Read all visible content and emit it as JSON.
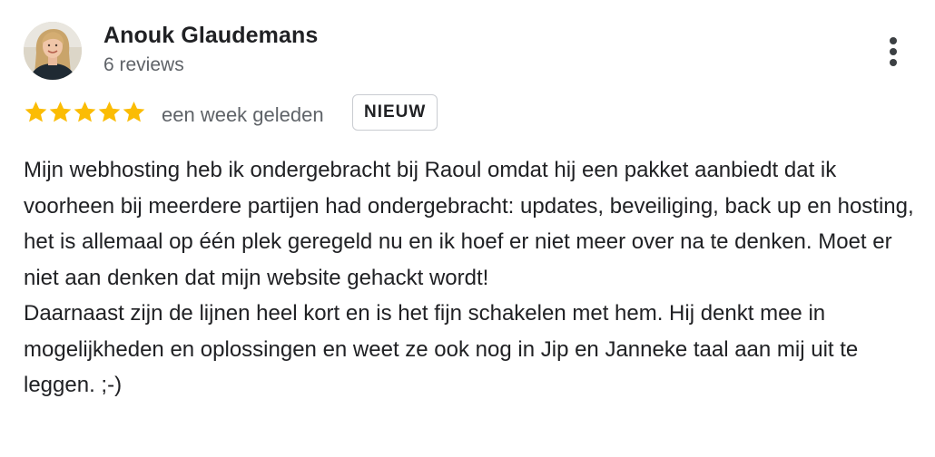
{
  "review": {
    "author_name": "Anouk Glaudemans",
    "review_count": "6 reviews",
    "rating": 5,
    "rating_max": 5,
    "date": "een week geleden",
    "badge": "NIEUW",
    "text_paragraphs": [
      "Mijn webhosting heb ik ondergebracht bij Raoul omdat hij een pakket aanbiedt dat ik voorheen bij meerdere partijen had ondergebracht: updates, beveiliging, back up en hosting, het is allemaal op één plek geregeld nu en ik hoef er niet meer over na te denken. Moet er niet aan denken dat mijn website gehackt wordt!",
      "Daarnaast zijn de lijnen heel kort en is het fijn schakelen met hem. Hij denkt mee in mogelijkheden en oplossingen en weet ze ook nog in Jip en Janneke taal aan mij uit te leggen. ;-)"
    ]
  },
  "icons": {
    "star": "star-icon",
    "more": "more-vertical-icon",
    "avatar": "avatar"
  },
  "colors": {
    "star": "#fbbc04",
    "secondary_text": "#5f6368",
    "primary_text": "#202124",
    "badge_border": "#c9ccd1"
  }
}
